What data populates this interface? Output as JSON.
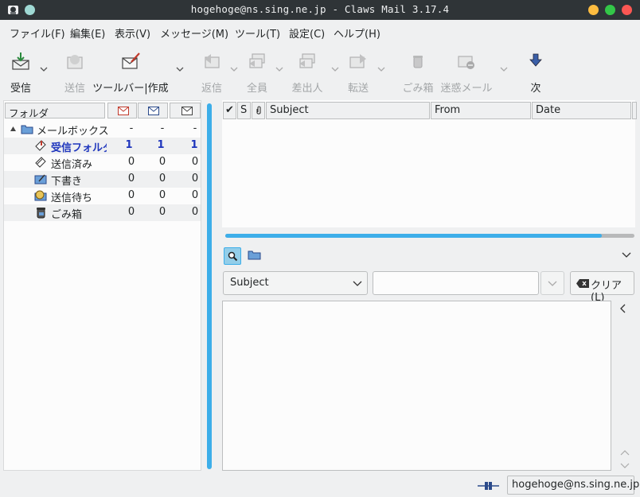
{
  "window": {
    "title": "hogehoge@ns.sing.ne.jp - Claws Mail 3.17.4",
    "buttons": {
      "minimize_color": "#fdbc40",
      "maximize_color": "#33c748",
      "close_color": "#fc5753"
    }
  },
  "menubar": {
    "items": [
      "ファイル(F)",
      "編集(E)",
      "表示(V)",
      "メッセージ(M)",
      "ツール(T)",
      "設定(C)",
      "ヘルプ(H)"
    ]
  },
  "toolbar": {
    "items": [
      {
        "label": "受信",
        "icon": "inbox-receive-icon",
        "enabled": true,
        "dropdown": true
      },
      {
        "label": "送信",
        "icon": "send-icon",
        "enabled": false,
        "dropdown": false
      },
      {
        "label": "ツールバー|作成",
        "icon": "compose-icon",
        "enabled": true,
        "dropdown": true
      },
      {
        "label": "返信",
        "icon": "reply-icon",
        "enabled": false,
        "dropdown": true
      },
      {
        "label": "全員",
        "icon": "reply-all-icon",
        "enabled": false,
        "dropdown": true
      },
      {
        "label": "差出人",
        "icon": "reply-sender-icon",
        "enabled": false,
        "dropdown": true
      },
      {
        "label": "転送",
        "icon": "forward-icon",
        "enabled": false,
        "dropdown": true
      },
      {
        "label": "ごみ箱",
        "icon": "trash-icon",
        "enabled": false,
        "dropdown": false
      },
      {
        "label": "迷惑メール",
        "icon": "spam-icon",
        "enabled": false,
        "dropdown": true
      },
      {
        "label": "次",
        "icon": "next-arrow-icon",
        "enabled": true,
        "dropdown": false
      }
    ]
  },
  "folders": {
    "header": {
      "name": "フォルダ",
      "new_icon": "new-mail-icon",
      "unread_icon": "unread-mail-icon",
      "total_icon": "total-mail-icon"
    },
    "rows": [
      {
        "name": "メールボックス",
        "icon": "mailbox-folder-icon",
        "new": "-",
        "unread": "-",
        "total": "-",
        "expanded": true
      },
      {
        "name": "受信フォルダ",
        "icon": "inbox-folder-icon",
        "new": "1",
        "unread": "1",
        "total": "1",
        "bold": true
      },
      {
        "name": "送信済み",
        "icon": "sent-folder-icon",
        "new": "0",
        "unread": "0",
        "total": "0"
      },
      {
        "name": "下書き",
        "icon": "draft-folder-icon",
        "new": "0",
        "unread": "0",
        "total": "0"
      },
      {
        "name": "送信待ち",
        "icon": "queue-folder-icon",
        "new": "0",
        "unread": "0",
        "total": "0"
      },
      {
        "name": "ごみ箱",
        "icon": "trash-folder-icon",
        "new": "0",
        "unread": "0",
        "total": "0"
      }
    ]
  },
  "message_list": {
    "columns": {
      "mark": "✔",
      "status": "S",
      "attach": "🖇",
      "subject": "Subject",
      "from": "From",
      "date": "Date"
    }
  },
  "progress": {
    "fraction": 0.92
  },
  "quick_search": {
    "type_selected": "Subject",
    "input_value": "",
    "clear_label": "クリア(L)"
  },
  "status": {
    "account": "hogehoge@ns.sing.ne.jp"
  },
  "colors": {
    "accent": "#3daee9",
    "bold_folder": "#1f36bd"
  }
}
